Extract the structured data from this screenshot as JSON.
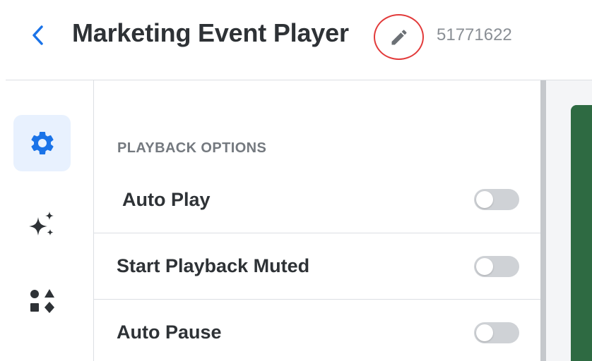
{
  "header": {
    "back_icon": "chevron-left-icon",
    "title": "Marketing Event Player",
    "edit_icon": "pencil-icon",
    "player_id": "51771622"
  },
  "rail": {
    "items": [
      {
        "icon": "gear-icon",
        "active": true
      },
      {
        "icon": "sparkles-icon",
        "active": false
      },
      {
        "icon": "shapes-icon",
        "active": false
      }
    ]
  },
  "panel": {
    "section_title": "PLAYBACK OPTIONS",
    "options": [
      {
        "label": "Auto Play",
        "enabled": false
      },
      {
        "label": "Start Playback Muted",
        "enabled": false
      },
      {
        "label": "Auto Pause",
        "enabled": false
      }
    ]
  },
  "colors": {
    "accent": "#1a73e8",
    "active_bg": "#e8f1fe",
    "edit_highlight": "#e23a3a",
    "preview": "#2e6a42"
  }
}
